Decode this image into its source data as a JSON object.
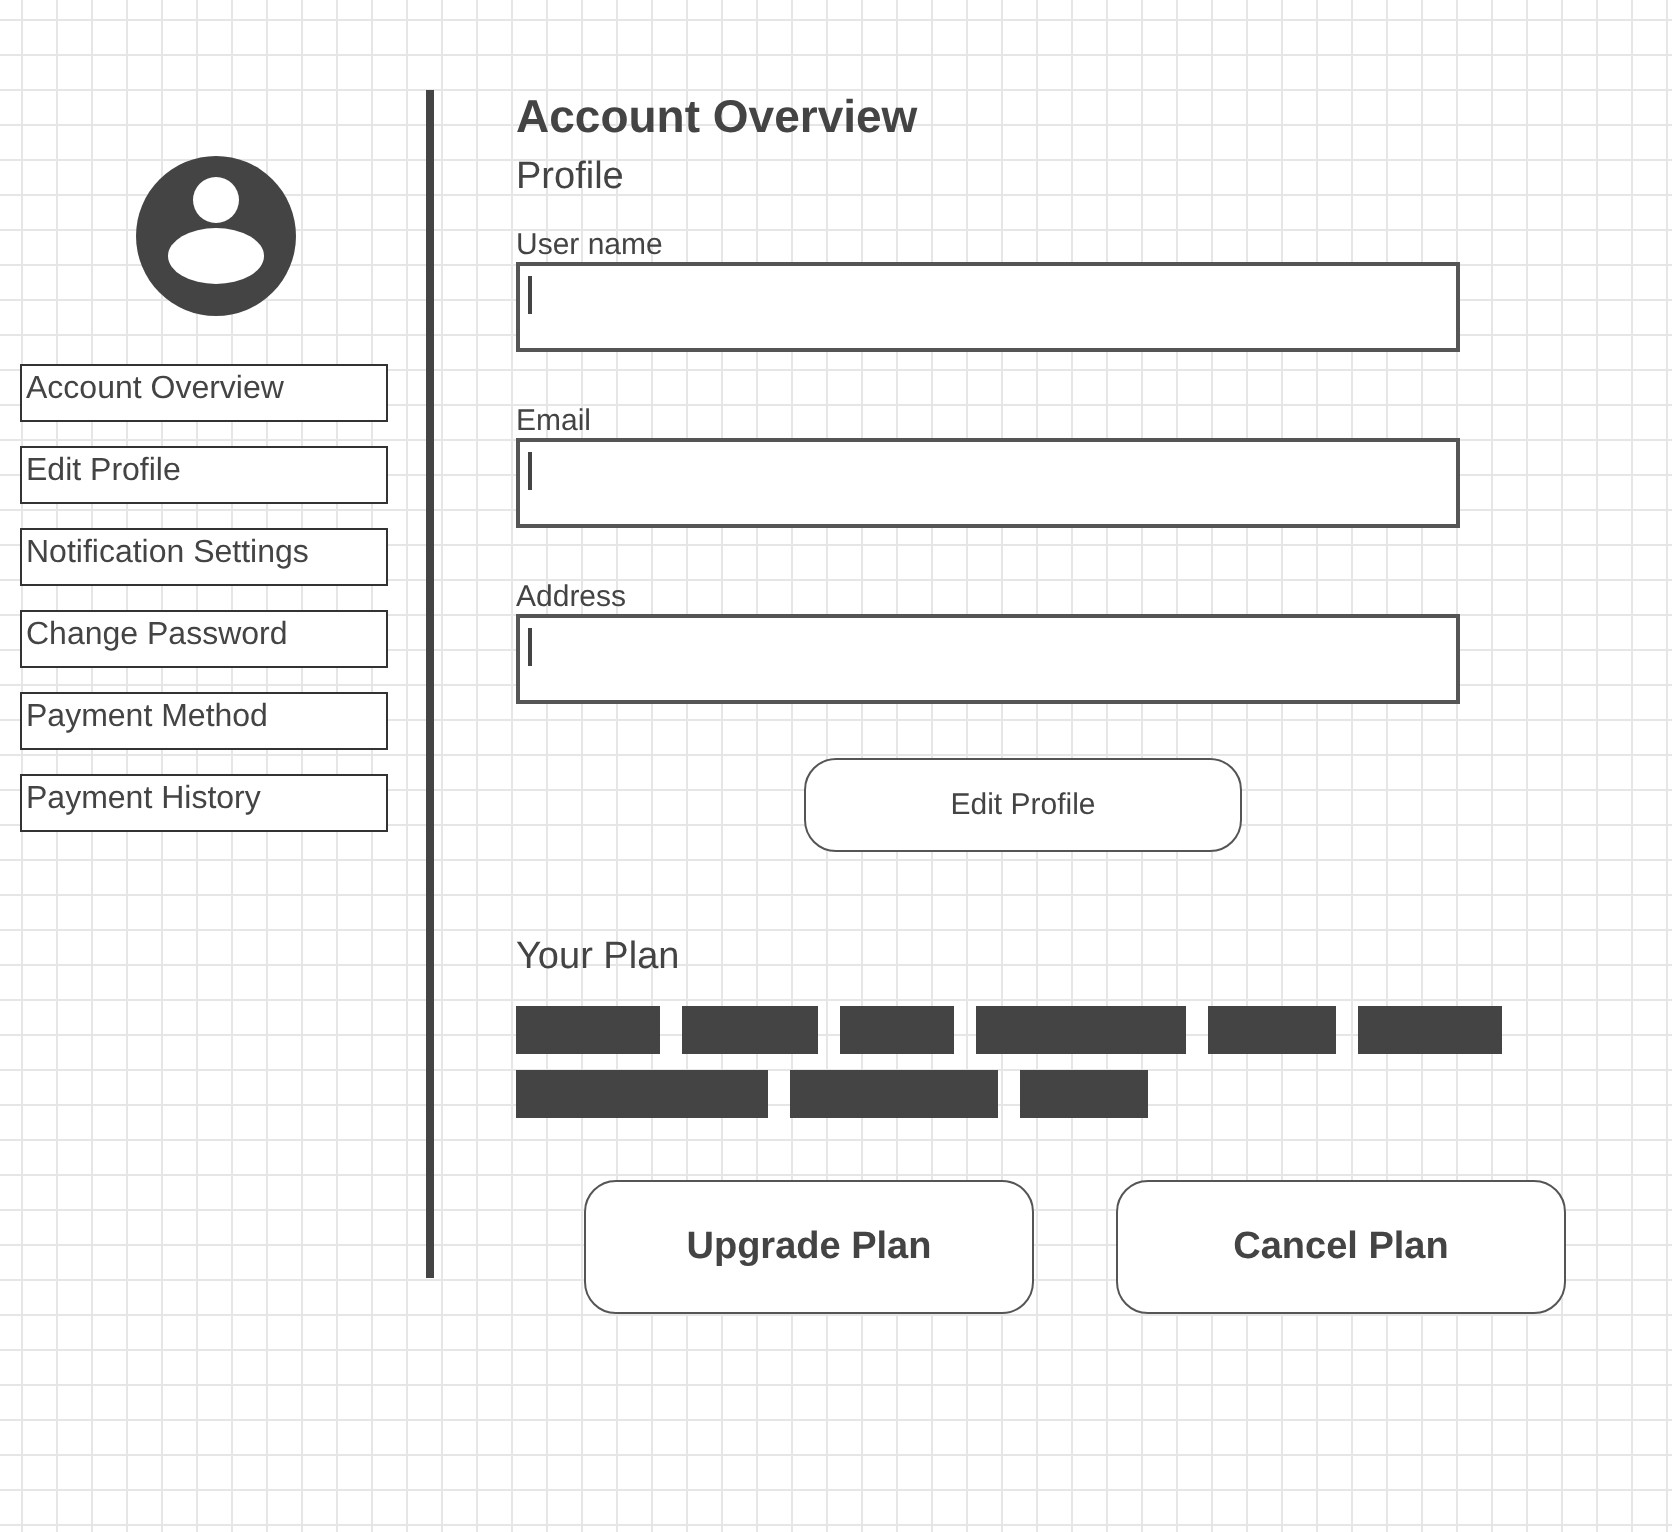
{
  "sidebar": {
    "items": [
      {
        "label": "Account Overview"
      },
      {
        "label": "Edit Profile"
      },
      {
        "label": "Notification Settings"
      },
      {
        "label": "Change Password"
      },
      {
        "label": "Payment Method"
      },
      {
        "label": "Payment History"
      }
    ]
  },
  "main": {
    "title": "Account Overview",
    "section": "Profile",
    "fields": [
      {
        "label": "User name",
        "cursor": true
      },
      {
        "label": "Email",
        "cursor": true
      },
      {
        "label": "Address",
        "cursor": true
      }
    ],
    "edit_button": "Edit Profile",
    "plan": {
      "title": "Your Plan",
      "buttons": [
        "Upgrade Plan",
        "Cancel Plan"
      ]
    }
  }
}
